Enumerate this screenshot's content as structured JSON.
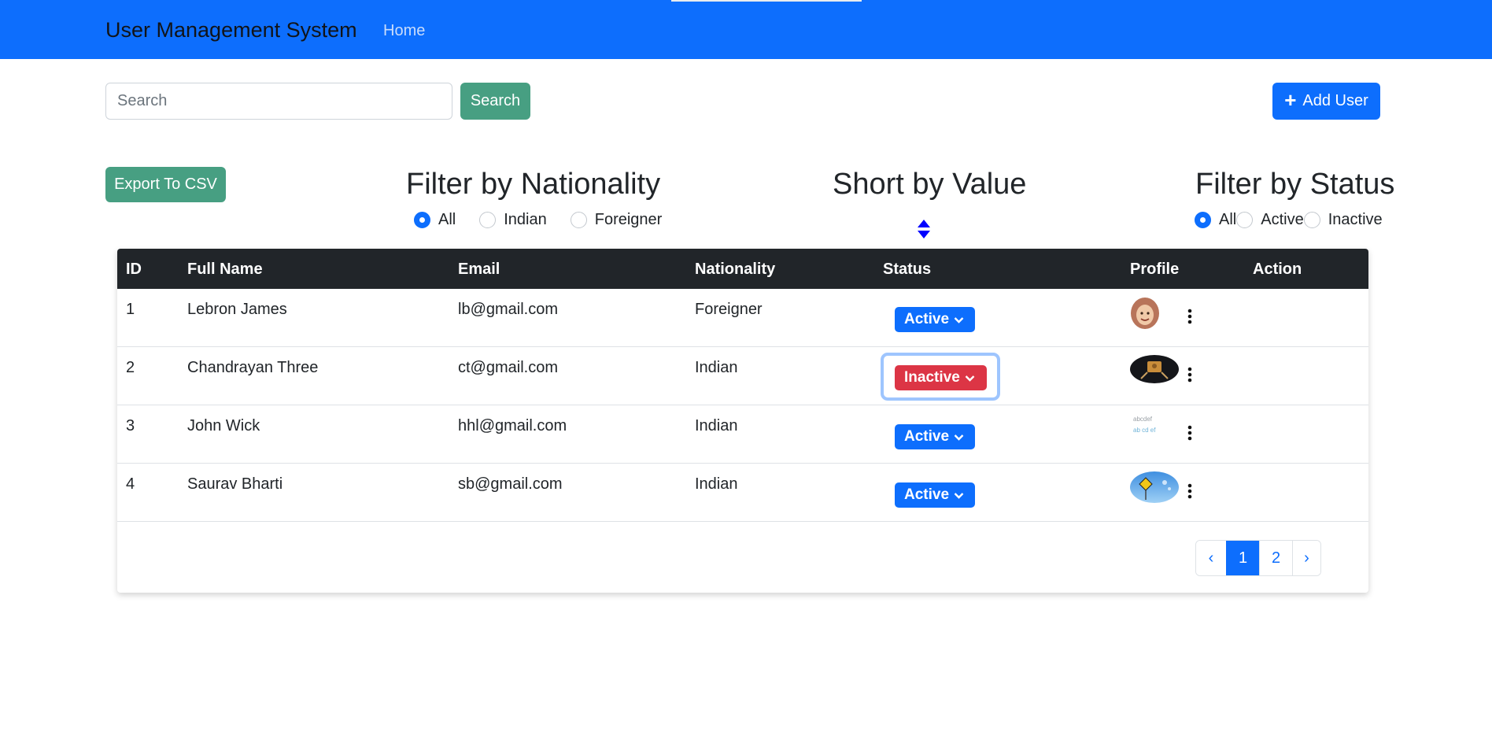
{
  "navbar": {
    "brand": "User Management System",
    "home": "Home"
  },
  "search": {
    "placeholder": "Search",
    "value": "",
    "button_label": "Search"
  },
  "add_user_label": "Add User",
  "export_label": "Export To CSV",
  "filters": {
    "nationality": {
      "title": "Filter by Nationality",
      "options": [
        "All",
        "Indian",
        "Foreigner"
      ],
      "selected": "All"
    },
    "sort": {
      "title": "Short by Value",
      "icon": "sort-icon"
    },
    "status": {
      "title": "Filter by Status",
      "options": [
        "All",
        "Active",
        "Inactive"
      ],
      "selected": "All"
    }
  },
  "table": {
    "columns": [
      "ID",
      "Full Name",
      "Email",
      "Nationality",
      "Status",
      "Profile",
      "Action"
    ],
    "rows": [
      {
        "id": "1",
        "name": "Lebron James",
        "email": "lb@gmail.com",
        "nationality": "Foreigner",
        "status": "Active",
        "profile_icon": "avatar-icon",
        "action_icon": "kebab-menu-icon"
      },
      {
        "id": "2",
        "name": "Chandrayan Three",
        "email": "ct@gmail.com",
        "nationality": "Indian",
        "status": "Inactive",
        "profile_icon": "avatar-icon",
        "action_icon": "kebab-menu-icon"
      },
      {
        "id": "3",
        "name": "John Wick",
        "email": "hhl@gmail.com",
        "nationality": "Indian",
        "status": "Active",
        "profile_icon": "avatar-icon",
        "action_icon": "kebab-menu-icon"
      },
      {
        "id": "4",
        "name": "Saurav Bharti",
        "email": "sb@gmail.com",
        "nationality": "Indian",
        "status": "Active",
        "profile_icon": "avatar-icon",
        "action_icon": "kebab-menu-icon"
      }
    ]
  },
  "pagination": {
    "prev": "‹",
    "pages": [
      "1",
      "2"
    ],
    "current": "1",
    "next": "›"
  },
  "colors": {
    "primary": "#0d6efd",
    "success": "#479f82",
    "danger": "#dc3545",
    "dark": "#212529"
  }
}
